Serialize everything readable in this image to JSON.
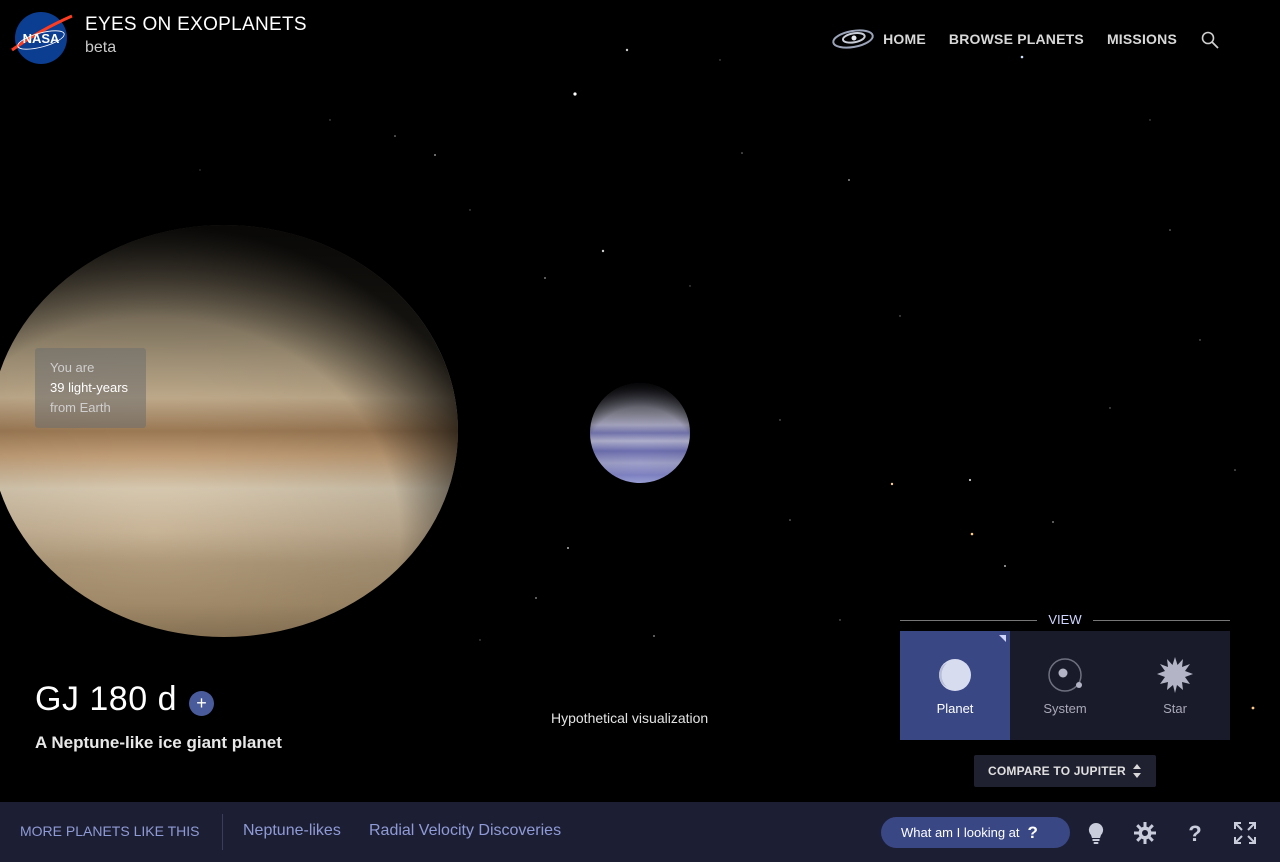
{
  "header": {
    "title": "EYES ON EXOPLANETS",
    "subtitle": "beta",
    "logo_text": "NASA",
    "nav": {
      "home": "HOME",
      "browse": "BROWSE PLANETS",
      "missions": "MISSIONS"
    },
    "icons": [
      "galaxy-icon",
      "search-icon"
    ]
  },
  "scene": {
    "distance": {
      "line1": "You are",
      "line2": "39 light-years",
      "line3": "from Earth"
    },
    "planet_name": "GJ 180 d",
    "add_label": "+",
    "planet_description": "A Neptune-like ice giant planet",
    "visualization_note": "Hypothetical visualization"
  },
  "view_panel": {
    "title": "VIEW",
    "options": [
      {
        "label": "Planet",
        "icon": "planet-icon",
        "active": true
      },
      {
        "label": "System",
        "icon": "system-icon",
        "active": false
      },
      {
        "label": "Star",
        "icon": "star-icon",
        "active": false
      }
    ],
    "compare_label": "COMPARE TO JUPITER"
  },
  "bottom_bar": {
    "more_label": "MORE PLANETS LIKE THIS",
    "links": [
      "Neptune-likes",
      "Radial Velocity Discoveries"
    ],
    "what_label": "What am I looking at",
    "what_icon": "?",
    "tools": [
      "lightbulb-icon",
      "gear-icon",
      "help-icon",
      "fullscreen-icon"
    ]
  },
  "colors": {
    "accent": "#394785",
    "bottom_bar": "#1c1e33",
    "link": "#8f9bd6"
  }
}
